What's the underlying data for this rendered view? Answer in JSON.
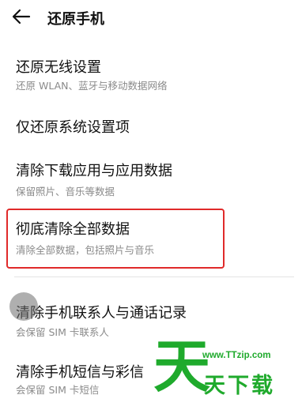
{
  "header": {
    "title": "还原手机",
    "back_icon": "arrow-left-icon"
  },
  "items": [
    {
      "title": "还原无线设置",
      "subtitle": "还原 WLAN、蓝牙与移动数据网络"
    },
    {
      "title": "仅还原系统设置项",
      "subtitle": ""
    },
    {
      "title": "清除下载应用与应用数据",
      "subtitle": "保留照片、音乐等数据"
    },
    {
      "title": "彻底清除全部数据",
      "subtitle": "清除全部数据，包括照片与音乐"
    },
    {
      "title": "清除手机联系人与通话记录",
      "subtitle": "会保留 SIM 卡联系人"
    },
    {
      "title": "清除手机短信与彩信",
      "subtitle": "会保留 SIM 卡短信"
    }
  ],
  "watermark": {
    "big_char": "天",
    "url": "www.TTzip.com",
    "text": "天下载"
  },
  "colors": {
    "highlight": "#e02a2a",
    "watermark": "#1faa2c"
  }
}
